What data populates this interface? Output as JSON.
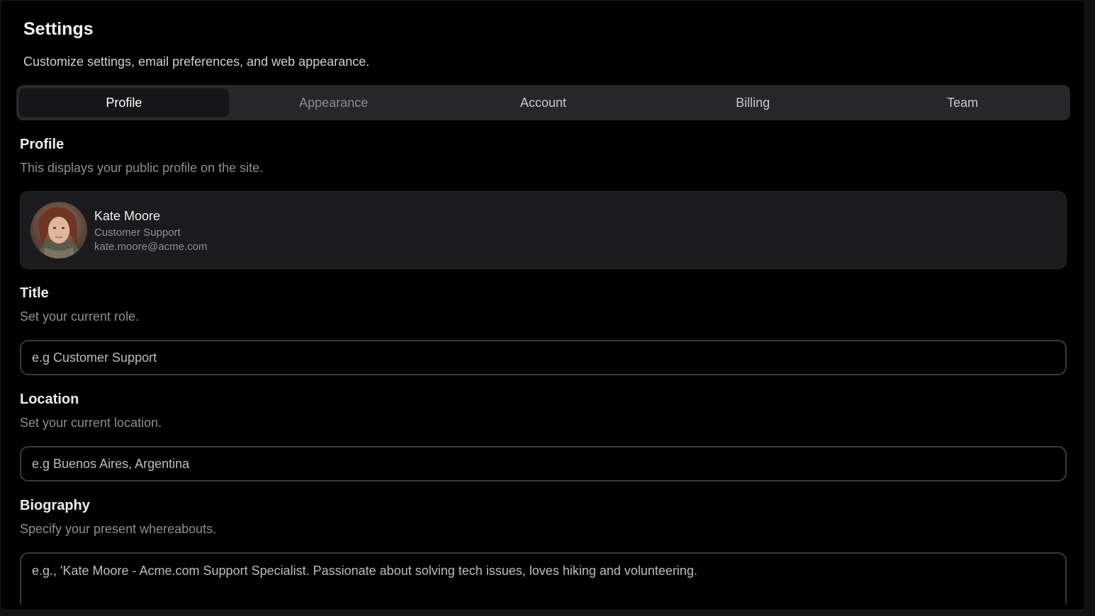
{
  "header": {
    "title": "Settings",
    "subtitle": "Customize settings, email preferences, and web appearance."
  },
  "tabs": [
    {
      "label": "Profile",
      "state": "active"
    },
    {
      "label": "Appearance",
      "state": "muted"
    },
    {
      "label": "Account",
      "state": "normal"
    },
    {
      "label": "Billing",
      "state": "normal"
    },
    {
      "label": "Team",
      "state": "normal"
    }
  ],
  "profile_section": {
    "title": "Profile",
    "description": "This displays your public profile on the site.",
    "card": {
      "name": "Kate Moore",
      "role": "Customer Support",
      "email": "kate.moore@acme.com",
      "avatar_icon": "user-avatar-photo"
    }
  },
  "title_section": {
    "title": "Title",
    "description": "Set your current role.",
    "placeholder": "e.g Customer Support"
  },
  "location_section": {
    "title": "Location",
    "description": "Set your current location.",
    "placeholder": "e.g Buenos Aires, Argentina"
  },
  "biography_section": {
    "title": "Biography",
    "description": "Specify your present whereabouts.",
    "placeholder": "e.g., 'Kate Moore - Acme.com Support Specialist. Passionate about solving tech issues, loves hiking and volunteering."
  },
  "colors": {
    "background": "#000000",
    "tab_bar": "#27272a",
    "active_tab": "#161618",
    "card": "#1b1b1e",
    "input_border": "#3a3a3e",
    "muted_text": "#8e8e93"
  }
}
